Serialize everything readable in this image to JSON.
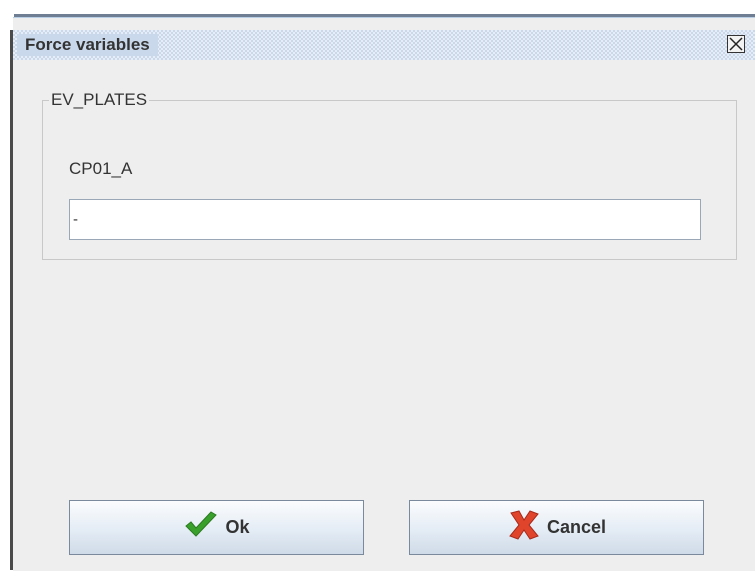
{
  "window": {
    "title": "Force variables"
  },
  "group": {
    "legend": "EV_PLATES",
    "field_label": "CP01_A",
    "field_value": "-"
  },
  "buttons": {
    "ok_label": "Ok",
    "cancel_label": "Cancel"
  },
  "icons": {
    "close": "close-icon",
    "ok": "checkmark-icon",
    "cancel": "red-x-icon"
  },
  "colors": {
    "titlebar": "#c9d8eb",
    "dialog_background": "#eeeeee",
    "checkmark_green": "#3aa02c",
    "cancel_red": "#e0452c"
  }
}
